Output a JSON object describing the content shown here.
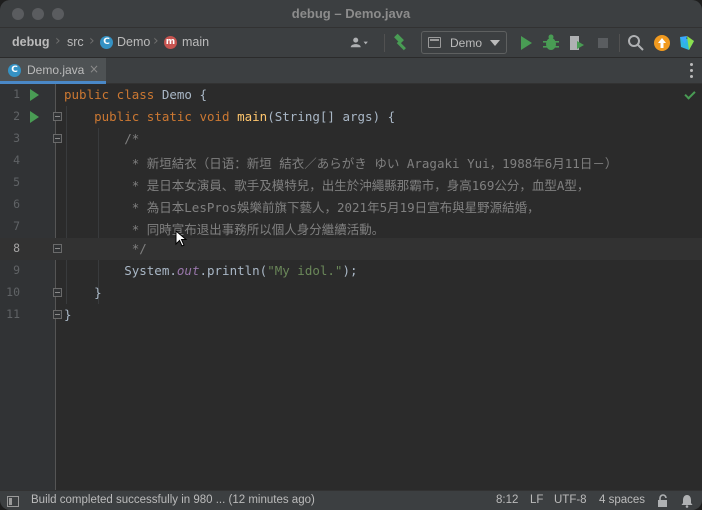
{
  "window": {
    "title": "debug – Demo.java"
  },
  "navbar": {
    "breadcrumbs": [
      "debug",
      "src",
      "Demo",
      "main"
    ],
    "run_config": "Demo"
  },
  "tabs": [
    {
      "label": "Demo.java",
      "close": "×"
    }
  ],
  "editor": {
    "line_numbers": [
      "1",
      "2",
      "3",
      "4",
      "5",
      "6",
      "7",
      "8",
      "9",
      "10",
      "11"
    ],
    "current_line": 8
  },
  "status": {
    "message": "Build completed successfully in 980 ... (12 minutes ago)",
    "position": "8:12",
    "line_separator": "LF",
    "encoding": "UTF-8",
    "indent": "4 spaces"
  },
  "colors": {
    "keyword": "#cc7832",
    "function": "#ffc66d",
    "comment": "#808080",
    "string": "#6a8759",
    "static_field": "#9876aa",
    "run_green": "#499c54",
    "accent_blue": "#4a88c7"
  },
  "icons": [
    "user-icon",
    "build-hammer-icon",
    "run-icon",
    "debug-icon",
    "coverage-icon",
    "stop-icon",
    "search-icon",
    "update-icon",
    "toolbox-icon",
    "checkmark-icon",
    "lock-icon",
    "notifications-icon"
  ]
}
